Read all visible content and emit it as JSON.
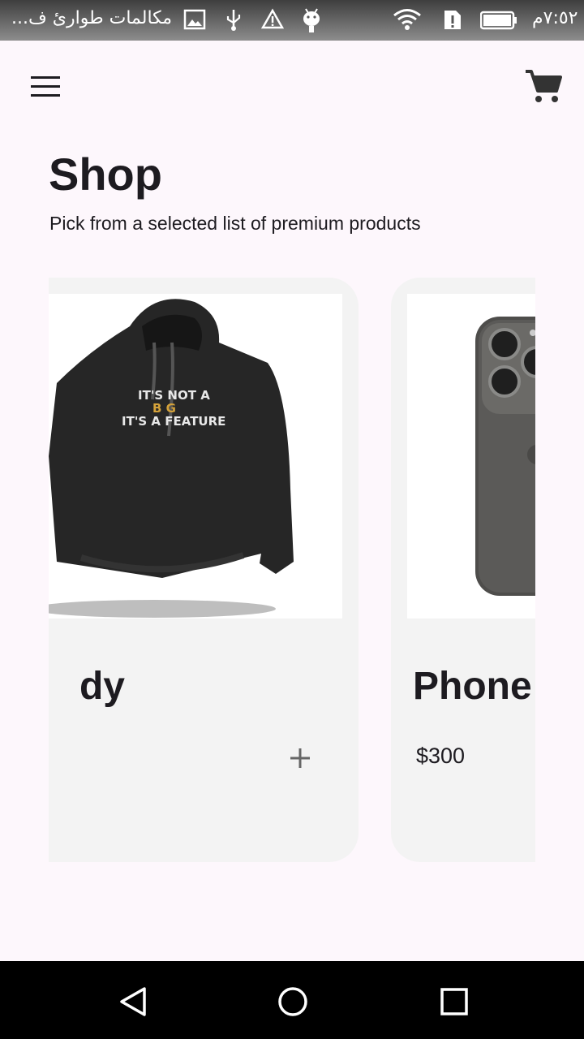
{
  "status_bar": {
    "notification_text": "مكالمات طوارئ ف...",
    "time": "٧:٥٢م",
    "icons": [
      "image-icon",
      "usb-icon",
      "warning-icon",
      "android-icon",
      "wifi-icon",
      "sim-alert-icon",
      "battery-icon"
    ]
  },
  "app_bar": {
    "menu_icon": "menu-icon",
    "cart_icon": "cart-icon"
  },
  "header": {
    "title": "Shop",
    "subtitle": "Pick from a selected list of premium products"
  },
  "products": [
    {
      "name": "dy",
      "image": "hoodie-image",
      "print_lines": [
        "IT'S NOT A",
        "B G",
        "IT'S A FEATURE"
      ],
      "add_icon": "plus-icon"
    },
    {
      "name": "Phone",
      "price": "$300",
      "image": "phone-image"
    }
  ],
  "nav_bar": {
    "buttons": [
      "back-icon",
      "home-icon",
      "recents-icon"
    ]
  },
  "colors": {
    "background": "#fdf7fc",
    "card": "#f3f3f3",
    "text": "#1d1b20",
    "status_bar": "#5a5a5a",
    "nav_bar": "#000000"
  }
}
